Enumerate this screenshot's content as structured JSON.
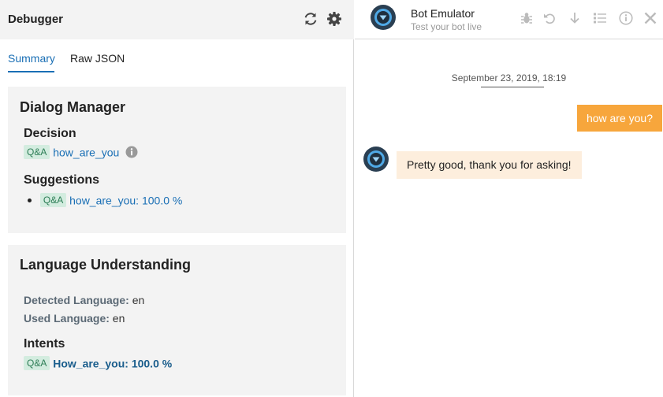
{
  "debugger": {
    "title": "Debugger",
    "tabs": [
      {
        "label": "Summary",
        "active": true
      },
      {
        "label": "Raw JSON",
        "active": false
      }
    ],
    "dialog_manager": {
      "title": "Dialog Manager",
      "decision_title": "Decision",
      "decision": {
        "badge": "Q&A",
        "name": "how_are_you"
      },
      "suggestions_title": "Suggestions",
      "suggestions": [
        {
          "badge": "Q&A",
          "text": "how_are_you: 100.0 %"
        }
      ]
    },
    "language_understanding": {
      "title": "Language Understanding",
      "detected_label": "Detected Language:",
      "detected_value": "en",
      "used_label": "Used Language:",
      "used_value": "en",
      "intents_title": "Intents",
      "intents": [
        {
          "badge": "Q&A",
          "text": "How_are_you: 100.0 %"
        }
      ]
    },
    "icons": [
      "refresh-icon",
      "gear-icon"
    ]
  },
  "emulator": {
    "title": "Bot Emulator",
    "subtitle": "Test your bot live",
    "icons": [
      "bug-icon",
      "undo-icon",
      "download-icon",
      "list-icon",
      "info-icon",
      "close-icon"
    ],
    "timestamp": "September 23, 2019, 18:19",
    "messages": [
      {
        "from": "user",
        "text": "how are you?"
      },
      {
        "from": "bot",
        "text": "Pretty good, thank you for asking!"
      }
    ]
  },
  "colors": {
    "accent": "#1a6fb5",
    "user_bubble": "#f7a63c",
    "bot_bubble": "#fdeedd",
    "badge_bg": "#d3ecdf",
    "badge_text": "#2c7d55",
    "panel_bg": "#f3f3f3"
  }
}
